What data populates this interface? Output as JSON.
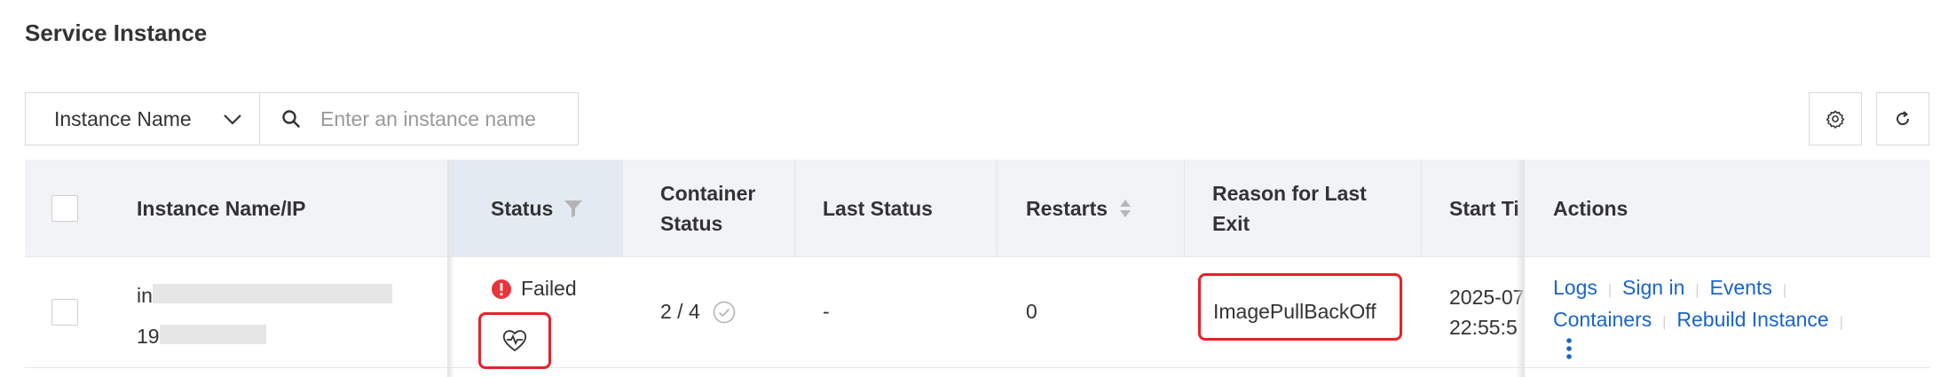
{
  "page": {
    "title": "Service Instance"
  },
  "filter": {
    "select_value": "Instance Name",
    "search_placeholder": "Enter an instance name"
  },
  "toolbar": {
    "settings_icon": "gear-icon",
    "refresh_icon": "refresh-icon"
  },
  "table": {
    "columns": {
      "name": "Instance Name/IP",
      "status": "Status",
      "container_status_1": "Container",
      "container_status_2": "Status",
      "last_status": "Last Status",
      "restarts": "Restarts",
      "reason_1": "Reason for Last",
      "reason_2": "Exit",
      "start_time": "Start Ti",
      "actions": "Actions"
    },
    "rows": [
      {
        "name_prefix": "in",
        "ip_prefix": "19",
        "status": "Failed",
        "container_status": "2 / 4",
        "last_status": "-",
        "restarts": "0",
        "reason": "ImagePullBackOff",
        "start_date": "2025-07",
        "start_time": "22:55:5",
        "actions": {
          "logs": "Logs",
          "sign_in": "Sign in",
          "events": "Events",
          "containers": "Containers",
          "rebuild": "Rebuild Instance"
        }
      }
    ]
  },
  "colors": {
    "link": "#1a64c8",
    "error": "#e8343b",
    "highlight": "#e8202a"
  }
}
